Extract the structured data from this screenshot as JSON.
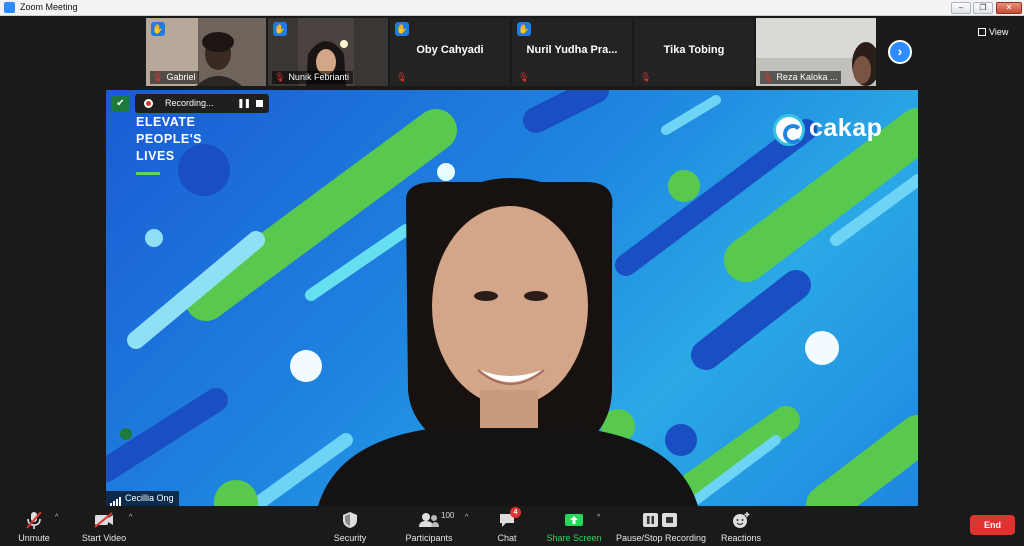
{
  "window": {
    "title": "Zoom Meeting",
    "controls": [
      "minimize",
      "restore",
      "close"
    ]
  },
  "gallery": {
    "participants": [
      {
        "name": "Gabriel",
        "caption": "Gabriel",
        "video": true,
        "muted": true
      },
      {
        "name": "Nunik Febrianti",
        "caption": "Nunik Febrianti",
        "video": true,
        "muted": true
      },
      {
        "name": "Oby Cahyadi",
        "caption": "",
        "video": false,
        "muted": true
      },
      {
        "name": "Nuril Yudha  Pra...",
        "caption": "",
        "video": false,
        "muted": true
      },
      {
        "name": "Tika Tobing",
        "caption": "",
        "video": false,
        "muted": true
      },
      {
        "name": "Reza Kaloka ...",
        "caption": "Reza Kaloka ...",
        "video": true,
        "muted": true
      }
    ],
    "view_label": "View"
  },
  "stage": {
    "recording_label": "Recording...",
    "tagline": [
      "ELEVATE",
      "PEOPLE'S",
      "LIVES"
    ],
    "logo_text": "cakap",
    "speaker_name": "Cecillia Ong"
  },
  "toolbar": {
    "unmute": "Unmute",
    "start_video": "Start Video",
    "security": "Security",
    "participants": "Participants",
    "participant_count": "100",
    "chat": "Chat",
    "chat_badge": "4",
    "share_screen": "Share Screen",
    "pause_stop": "Pause/Stop Recording",
    "reactions": "Reactions",
    "end": "End"
  },
  "colors": {
    "accent": "#2d8cff",
    "danger": "#e0322f",
    "share_green": "#23d959",
    "stage_blue": "#1f86e0",
    "stage_green": "#5fd36a"
  }
}
